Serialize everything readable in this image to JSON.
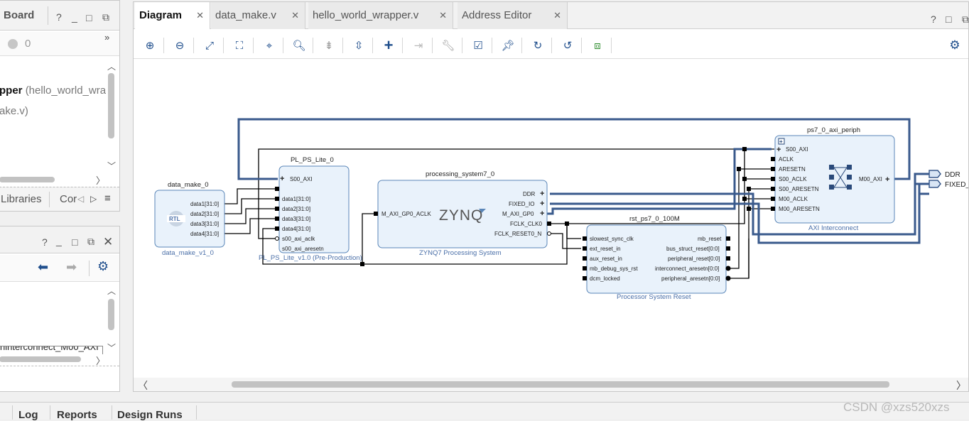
{
  "left_top_panel": {
    "title": "Board",
    "count": "0",
    "overflow": "»",
    "tree": {
      "wrapper_name": "pper",
      "wrapper_detail": "(hello_world_wrap",
      "child": "ake.v)"
    },
    "bottom_tabs": [
      "Libraries",
      "Cor"
    ]
  },
  "left_bottom_panel": {
    "tree_text": "ninterconnect_M00_AXI"
  },
  "tabs": [
    {
      "label": "Diagram",
      "active": true
    },
    {
      "label": "data_make.v",
      "active": false
    },
    {
      "label": "hello_world_wrapper.v",
      "active": false
    },
    {
      "label": "Address Editor",
      "active": false
    }
  ],
  "toolbar_icons": [
    "zoom-in-icon",
    "zoom-out-icon",
    "zoom-fit-icon",
    "fit-selection-icon",
    "auto-connect-icon",
    "search-icon",
    "collapse-icon",
    "expand-icon",
    "add-ip-icon",
    "make-external-icon",
    "properties-icon",
    "validate-icon",
    "pin-icon",
    "regenerate-icon",
    "optimize-routing-icon",
    "hierarchy-icon",
    "settings-icon"
  ],
  "diagram": {
    "blocks": {
      "data_make": {
        "title": "data_make_0",
        "subtitle": "data_make_v1_0",
        "badge": "RTL",
        "ports": [
          "data1[31:0]",
          "data2[31:0]",
          "data3[31:0]",
          "data4[31:0]"
        ]
      },
      "pl_ps_lite": {
        "title": "PL_PS_Lite_0",
        "subtitle": "PL_PS_Lite_v1.0 (Pre-Production)",
        "ports": [
          "S00_AXI",
          "data1[31:0]",
          "data2[31:0]",
          "data3[31:0]",
          "data4[31:0]",
          "s00_axi_aclk",
          "s00_axi_aresetn"
        ]
      },
      "ps7": {
        "title": "processing_system7_0",
        "subtitle": "ZYNQ7 Processing System",
        "logo": "ZYNQ",
        "in_ports": [
          "M_AXI_GP0_ACLK"
        ],
        "out_ports": [
          "DDR",
          "FIXED_IO",
          "M_AXI_GP0",
          "FCLK_CLK0",
          "FCLK_RESET0_N"
        ]
      },
      "rst": {
        "title": "rst_ps7_0_100M",
        "subtitle": "Processor System Reset",
        "in_ports": [
          "slowest_sync_clk",
          "ext_reset_in",
          "aux_reset_in",
          "mb_debug_sys_rst",
          "dcm_locked"
        ],
        "out_ports": [
          "mb_reset",
          "bus_struct_reset[0:0]",
          "peripheral_reset[0:0]",
          "interconnect_aresetn[0:0]",
          "peripheral_aresetn[0:0]"
        ]
      },
      "axi": {
        "title": "ps7_0_axi_periph",
        "subtitle": "AXI Interconnect",
        "in_ports": [
          "S00_AXI",
          "ACLK",
          "ARESETN",
          "S00_ACLK",
          "S00_ARESETN",
          "M00_ACLK",
          "M00_ARESETN"
        ],
        "out_ports": [
          "M00_AXI"
        ]
      }
    },
    "external_ports": [
      "DDR",
      "FIXED_"
    ]
  },
  "bottom_tabs": [
    "Log",
    "Reports",
    "Design Runs"
  ],
  "watermark": "CSDN @xzs520xzs"
}
